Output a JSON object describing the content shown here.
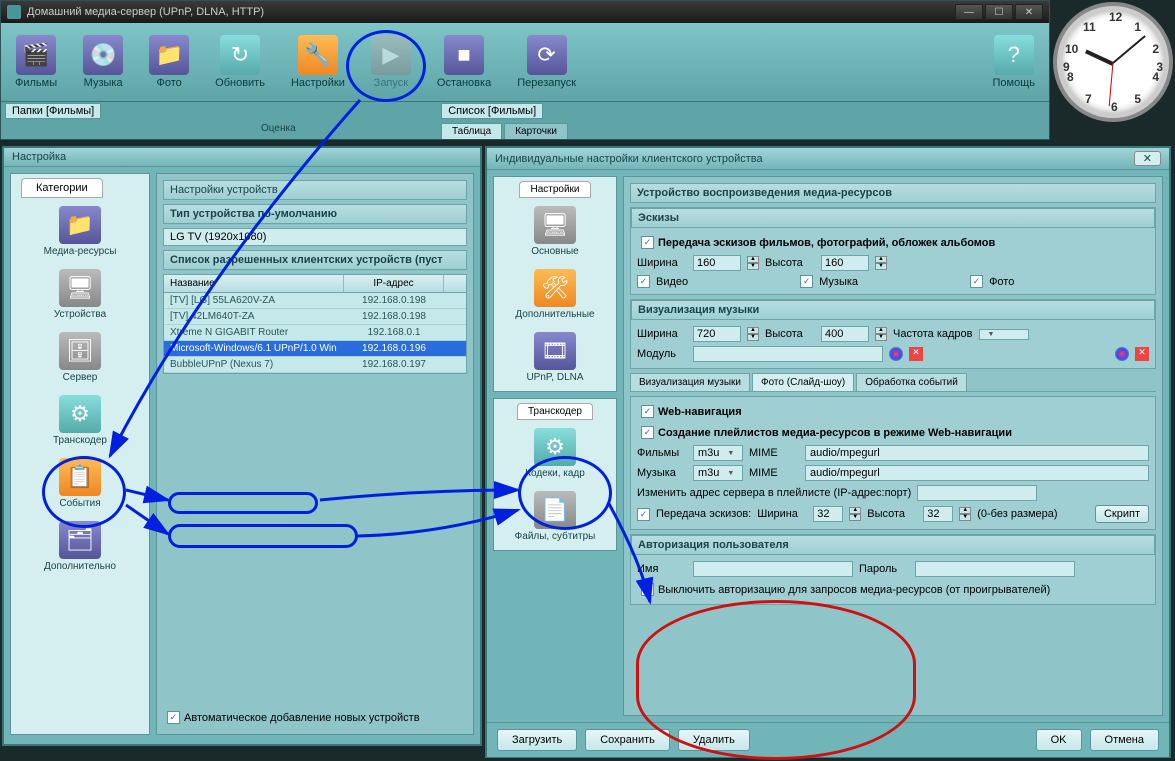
{
  "window": {
    "title": "Домашний медиа-сервер (UPnP, DLNA, HTTP)"
  },
  "toolbar": {
    "films": "Фильмы",
    "music": "Музыка",
    "photo": "Фото",
    "refresh": "Обновить",
    "settings": "Настройки",
    "start": "Запуск",
    "stop": "Остановка",
    "restart": "Перезапуск",
    "help": "Помощь"
  },
  "subbar": {
    "folders": "Папки [Фильмы]",
    "list": "Список [Фильмы]",
    "rating": "Оценка",
    "tab_table": "Таблица",
    "tab_cards": "Карточки"
  },
  "settings": {
    "title": "Настройка",
    "categories_tab": "Категории",
    "cats": {
      "media": "Медиа-ресурсы",
      "devices": "Устройства",
      "server": "Сервер",
      "transcoder": "Транскодер",
      "events": "События",
      "advanced": "Дополнительно"
    },
    "panel_head": "Настройки устройств",
    "default_type_head": "Тип устройства по-умолчанию",
    "default_type_value": "LG TV (1920x1080)",
    "devlist_head": "Список разрешенных клиентских устройств (пуст",
    "col_name": "Название",
    "col_ip": "IP-адрес",
    "rows": [
      {
        "name": "[TV] [LG] 55LA620V-ZA",
        "ip": "192.168.0.198"
      },
      {
        "name": "[TV] 42LM640T-ZA",
        "ip": "192.168.0.198"
      },
      {
        "name": "Xtreme N GIGABIT Router",
        "ip": "192.168.0.1"
      },
      {
        "name": "Microsoft-Windows/6.1 UPnP/1.0 Win",
        "ip": "192.168.0.196"
      },
      {
        "name": "BubbleUPnP (Nexus 7)",
        "ip": "192.168.0.197"
      }
    ],
    "selected_row": 3,
    "autoadd": "Автоматическое добавление новых устройств"
  },
  "device_dlg": {
    "title": "Индивидуальные настройки клиентского устройства",
    "side_settings": "Настройки",
    "side_main": "Основные",
    "side_extra": "Дополнительные",
    "side_upnp": "UPnP, DLNA",
    "side_transcoder": "Транскодер",
    "side_codecs": "Кодеки, кадр",
    "side_files": "Файлы, субтитры",
    "main_head": "Устройство воспроизведения медиа-ресурсов",
    "thumbs": {
      "head": "Эскизы",
      "transfer": "Передача эскизов фильмов, фотографий, обложек альбомов",
      "width_lbl": "Ширина",
      "width": "160",
      "height_lbl": "Высота",
      "height": "160",
      "video": "Видео",
      "music": "Музыка",
      "photo": "Фото"
    },
    "musicviz": {
      "head": "Визуализация музыки",
      "width": "720",
      "height": "400",
      "fps_lbl": "Частота кадров",
      "module_lbl": "Модуль"
    },
    "subtabs": {
      "musicviz": "Визуализация музыки",
      "slideshow": "Фото (Слайд-шоу)",
      "events": "Обработка событий"
    },
    "webnav": {
      "head": "Web-навигация",
      "playlists": "Создание плейлистов медиа-ресурсов в режиме Web-навигации",
      "films_lbl": "Фильмы",
      "films_fmt": "m3u",
      "music_lbl": "Музыка",
      "music_fmt": "m3u",
      "mime_lbl": "MIME",
      "mime_val": "audio/mpegurl",
      "addr_lbl": "Изменить адрес сервера в плейлисте (IP-адрес:порт)",
      "thumbs": "Передача эскизов:",
      "w": "32",
      "h": "32",
      "zero_note": "(0-без размера)",
      "script": "Скрипт"
    },
    "auth": {
      "head": "Авторизация пользователя",
      "name_lbl": "Имя",
      "pass_lbl": "Пароль",
      "disable": "Выключить авторизацию для запросов медиа-ресурсов (от проигрывателей)"
    },
    "btns": {
      "load": "Загрузить",
      "save": "Сохранить",
      "delete": "Удалить",
      "ok": "OK",
      "cancel": "Отмена"
    }
  },
  "clock": {
    "hours": [
      "12",
      "1",
      "2",
      "3",
      "4",
      "5",
      "6",
      "7",
      "8",
      "9",
      "10",
      "11"
    ]
  }
}
